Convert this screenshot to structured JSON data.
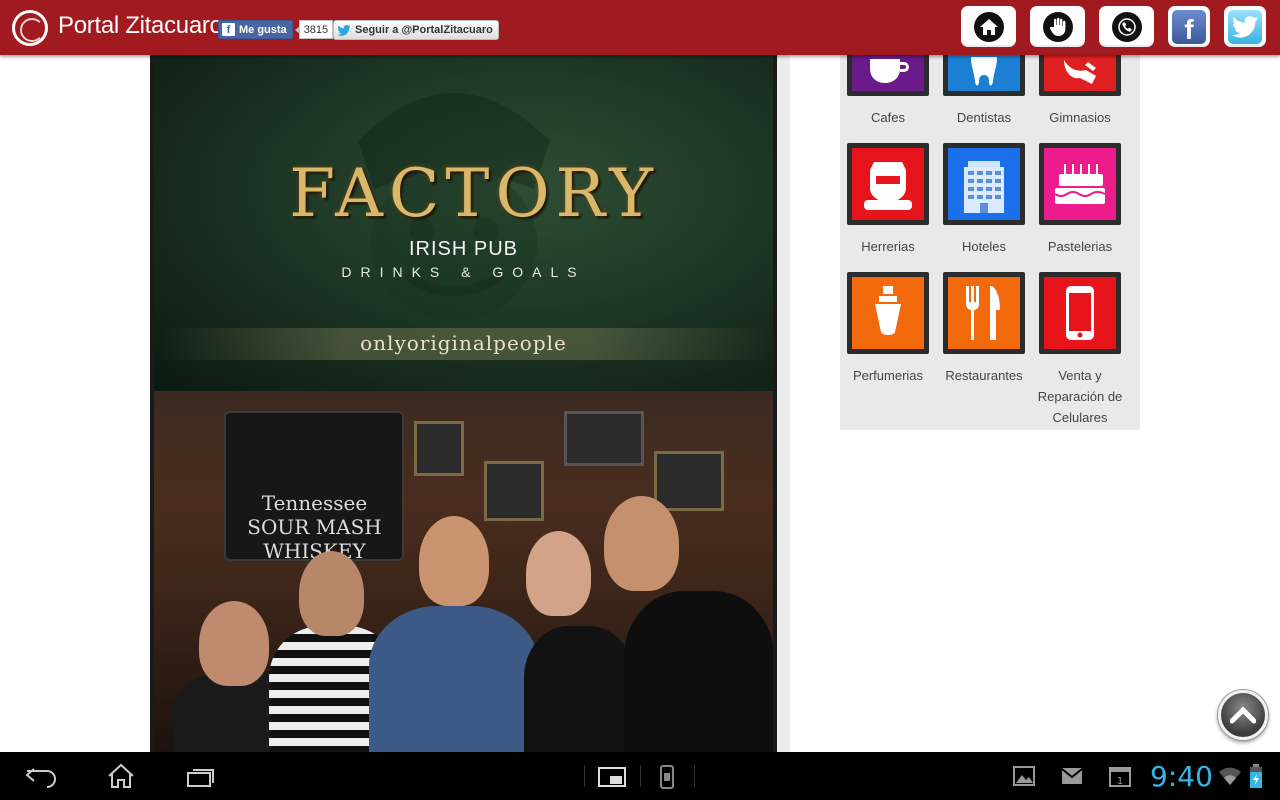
{
  "header": {
    "site_title": "Portal Zitacuaro",
    "fb_like_label": "Me gusta",
    "fb_like_count": "3815",
    "twitter_follow_label": "Seguir a @PortalZitacuaro",
    "nav_icons": [
      "home-icon",
      "hand-icon",
      "phone-icon",
      "facebook-icon",
      "twitter-icon"
    ]
  },
  "poster": {
    "logo_text": "FACTORY",
    "subtitle": "IRISH PUB",
    "tagline": "DRINKS & GOALS",
    "slogan": "onlyoriginalpeople",
    "sign_text": "Tennessee SOUR MASH WHISKEY"
  },
  "categories": {
    "partial_row": [
      {
        "label": "Cafes",
        "icon": "coffee-cup-icon",
        "color": "#6a1a8a"
      },
      {
        "label": "Dentistas",
        "icon": "tooth-icon",
        "color": "#1b7fd4"
      },
      {
        "label": "Gimnasios",
        "icon": "gym-icon",
        "color": "#e02020"
      }
    ],
    "items": [
      {
        "label": "Herrerias",
        "icon": "welder-mask-icon",
        "color": "#e8141b"
      },
      {
        "label": "Hoteles",
        "icon": "hotel-building-icon",
        "color": "#1b6fe8"
      },
      {
        "label": "Pastelerias",
        "icon": "cake-icon",
        "color": "#ec1c8c"
      },
      {
        "label": "Perfumerias",
        "icon": "perfume-icon",
        "color": "#f26a0c"
      },
      {
        "label": "Restaurantes",
        "icon": "fork-knife-icon",
        "color": "#f26a0c"
      },
      {
        "label": "Venta y Reparación de Celulares",
        "icon": "cellphone-icon",
        "color": "#e8141b"
      }
    ]
  },
  "system_bar": {
    "clock": "9:40",
    "accent": "#35b5e5"
  },
  "colors": {
    "header_bg": "#a01a1f",
    "panel_bg": "#e9e9e9"
  }
}
